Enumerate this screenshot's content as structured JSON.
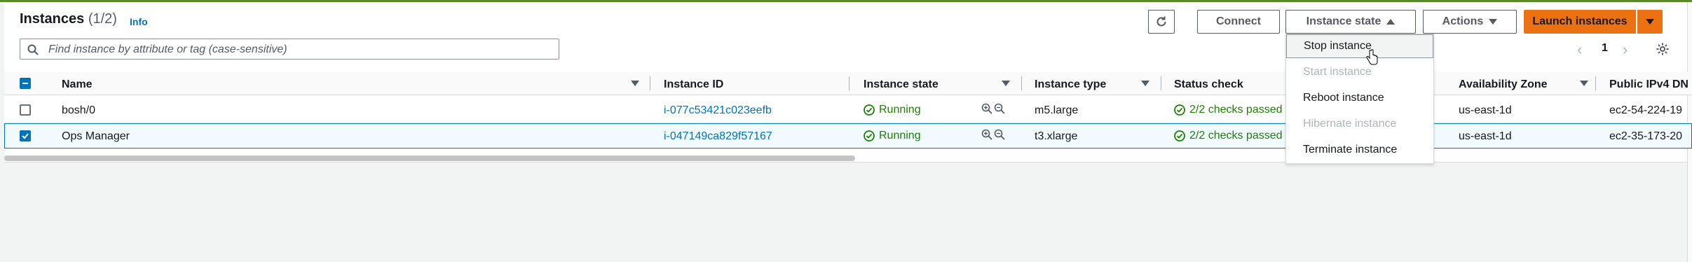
{
  "header": {
    "title": "Instances",
    "count": "(1/2)",
    "info": "Info"
  },
  "search": {
    "placeholder": "Find instance by attribute or tag (case-sensitive)"
  },
  "toolbar": {
    "connect": "Connect",
    "instance_state": "Instance state",
    "actions": "Actions",
    "launch": "Launch instances"
  },
  "pagination": {
    "current_page": "1"
  },
  "table": {
    "columns": {
      "name": "Name",
      "instance_id": "Instance ID",
      "instance_state": "Instance state",
      "instance_type": "Instance type",
      "status_check": "Status check",
      "availability_zone": "Availability Zone",
      "public_ipv4": "Public IPv4 DN"
    },
    "rows": [
      {
        "selected": false,
        "name": "bosh/0",
        "instance_id": "i-077c53421c023eefb",
        "state": "Running",
        "type": "m5.large",
        "status_check": "2/2 checks passed",
        "az": "us-east-1d",
        "public_dns": "ec2-54-224-19"
      },
      {
        "selected": true,
        "name": "Ops Manager",
        "instance_id": "i-047149ca829f57167",
        "state": "Running",
        "type": "t3.xlarge",
        "status_check": "2/2 checks passed",
        "az": "us-east-1d",
        "public_dns": "ec2-35-173-20"
      }
    ]
  },
  "instance_state_menu": {
    "items": [
      {
        "label": "Stop instance",
        "disabled": false,
        "hovered": true
      },
      {
        "label": "Start instance",
        "disabled": true
      },
      {
        "label": "Reboot instance",
        "disabled": false
      },
      {
        "label": "Hibernate instance",
        "disabled": true
      },
      {
        "label": "Terminate instance",
        "disabled": false
      }
    ]
  },
  "colors": {
    "accent": "#0073bb",
    "launch": "#ec7211",
    "running": "#1d8102",
    "disabled": "#aab7b8"
  }
}
